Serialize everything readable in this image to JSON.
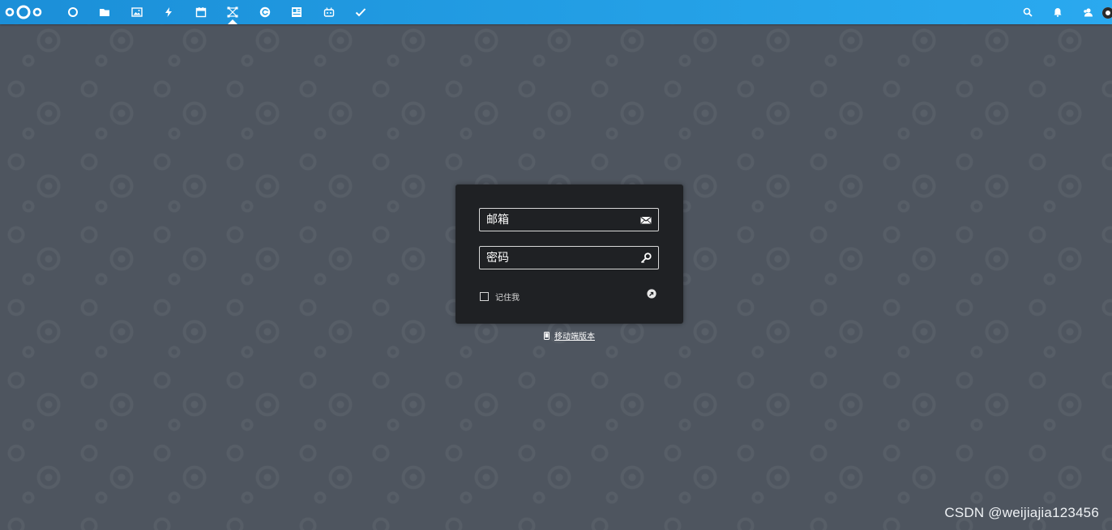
{
  "topbar": {
    "logo_icon": "nextcloud-logo-icon",
    "apps": [
      {
        "name": "dashboard",
        "icon": "circle-icon",
        "active": false
      },
      {
        "name": "files",
        "icon": "folder-icon",
        "active": false
      },
      {
        "name": "photos",
        "icon": "image-icon",
        "active": false
      },
      {
        "name": "activity",
        "icon": "lightning-icon",
        "active": false
      },
      {
        "name": "calendar",
        "icon": "calendar-icon",
        "active": false
      },
      {
        "name": "network",
        "icon": "network-icon",
        "active": true
      },
      {
        "name": "refresh",
        "icon": "refresh-icon",
        "active": false
      },
      {
        "name": "notes",
        "icon": "document-icon",
        "active": false
      },
      {
        "name": "robot",
        "icon": "robot-icon",
        "active": false
      },
      {
        "name": "tasks",
        "icon": "check-icon",
        "active": false
      }
    ],
    "right": [
      {
        "name": "search",
        "icon": "search-icon"
      },
      {
        "name": "notifications",
        "icon": "bell-icon"
      },
      {
        "name": "contacts",
        "icon": "contacts-icon"
      }
    ]
  },
  "login": {
    "email_placeholder": "邮箱",
    "email_icon": "envelope-icon",
    "password_placeholder": "密码",
    "password_icon": "key-icon",
    "remember_label": "记住我",
    "submit_icon": "arrow-circle-icon"
  },
  "mobile": {
    "label": "移动端版本",
    "icon": "phone-icon"
  },
  "watermark": "CSDN @weijiajia123456",
  "colors": {
    "topbar": "#24a0e6",
    "background": "#4e555f",
    "login_box": "#1f2124"
  }
}
